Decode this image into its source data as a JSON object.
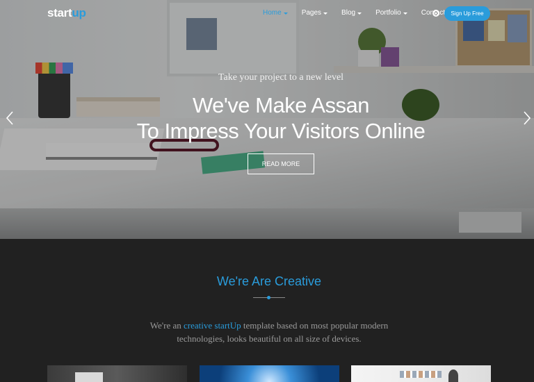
{
  "brand": {
    "logo_part1": "start",
    "logo_part2": "up"
  },
  "nav": {
    "items": [
      {
        "label": "Home",
        "active": true,
        "has_dropdown": true
      },
      {
        "label": "Pages",
        "active": false,
        "has_dropdown": true
      },
      {
        "label": "Blog",
        "active": false,
        "has_dropdown": true
      },
      {
        "label": "Portfolio",
        "active": false,
        "has_dropdown": true
      },
      {
        "label": "Contact",
        "active": false,
        "has_dropdown": false
      }
    ],
    "search_icon": "search-icon",
    "signup_label": "Sign Up Free"
  },
  "hero": {
    "subtitle": "Take your project to a new level",
    "title_line1": "We've Make Assan",
    "title_line2": "To Impress Your Visitors Online",
    "button_label": "READ MORE",
    "prev_icon": "chevron-left-icon",
    "next_icon": "chevron-right-icon"
  },
  "section": {
    "title": "We're Are Creative",
    "text_before": "We're an ",
    "text_highlight": "creative startUp",
    "text_after": " template based on most popular modern technologies, looks beautiful on all size of devices."
  },
  "colors": {
    "accent": "#2a9cdb",
    "section_bg": "#212121",
    "text_muted": "#9a9a9a"
  }
}
